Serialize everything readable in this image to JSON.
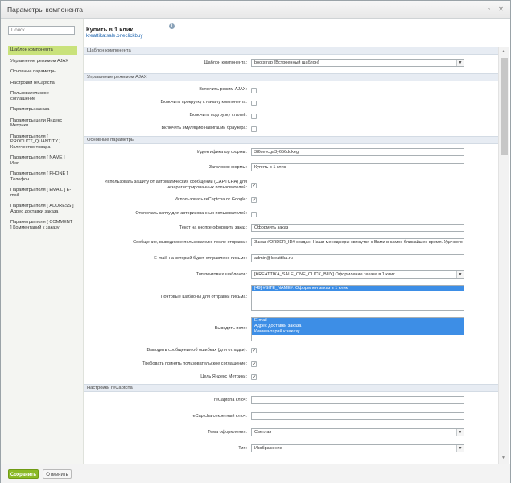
{
  "window": {
    "title": "Параметры компонента"
  },
  "sidebar": {
    "search_placeholder": "Поиск",
    "items": [
      {
        "label": "Шаблон компонента"
      },
      {
        "label": "Управление режимом AJAX"
      },
      {
        "label": "Основные параметры"
      },
      {
        "label": "Настройки reCaptcha"
      },
      {
        "label": "Пользовательское соглашение"
      },
      {
        "label": "Параметры заказа"
      },
      {
        "label": "Параметры цели Яндекс Метрики"
      },
      {
        "label": "Параметры поля [ PRODUCT_QUANTITY ] Количество товара"
      },
      {
        "label": "Параметры поля [ NAME ] Имя"
      },
      {
        "label": "Параметры поля [ PHONE ] Телефон"
      },
      {
        "label": "Параметры поля [ EMAIL ] E-mail"
      },
      {
        "label": "Параметры поля [ ADDRESS ] Адрес доставки заказа"
      },
      {
        "label": "Параметры поля [ COMMENT ] Комментарий к заказу"
      }
    ]
  },
  "header": {
    "component_name": "Купить в 1 клик",
    "component_code": "kreattika:sale.oneclickbuy"
  },
  "sections": {
    "template": "Шаблон компонента",
    "ajax": "Управление режимом AJAX",
    "main": "Основные параметры",
    "recaptcha": "Настройки reCaptcha"
  },
  "fields": {
    "template_label": "Шаблон компонента:",
    "template_value": "bootstrap (Встроенный шаблон)",
    "ajax_mode": "Включить режим AJAX:",
    "ajax_scroll": "Включить прокрутку к началу компонента:",
    "ajax_styles": "Включить подгрузку стилей:",
    "ajax_history": "Включить эмуляцию навигации браузера:",
    "form_id_label": "Идентификатор формы:",
    "form_id_value": "3f6cevcga3y656dokeg",
    "form_title_label": "Заголовок формы:",
    "form_title_value": "Купить в 1 клик",
    "captcha_label": "Использовать защиту от автоматических сообщений (CAPTCHA) для незарегистрированных пользователей:",
    "recaptcha_label": "Использовать reCaptcha от Google:",
    "disable_captcha_label": "Отключать капчу для авторизованных пользователей:",
    "button_text_label": "Текст на кнопке оформить заказ:",
    "button_text_value": "Оформить заказ",
    "message_label": "Сообщение, выводимое пользователю после отправки:",
    "message_value": "Заказ #ORDER_ID# создан. Наши менеджеры свяжутся с Вами в самое ближайшее время. Удачного дня!",
    "email_label": "E-mail, на который будет отправлено письмо:",
    "email_value": "admin@kreattika.ru",
    "event_type_label": "Тип почтовых шаблонов:",
    "event_type_value": "[KREATTIKA_SALE_ONE_CLICK_BUY] Оформление заказа в 1 клик",
    "mail_templates_label": "Почтовые шаблоны для отправки письма:",
    "mail_templates_options": [
      "[49] #SITE_NAME#: Оформлен заказ в 1 клик"
    ],
    "show_fields_label": "Выводить поля:",
    "show_fields_options": [
      "E-mail",
      "Адрес доставки заказа",
      "Комментарий к заказу"
    ],
    "show_errors_label": "Выводить сообщения об ошибках (для отладки):",
    "agreement_label": "Требовать принять пользовательское соглашение:",
    "metrika_label": "Цель Яндекс Метрики:",
    "rc_key_label": "reCaptcha ключ:",
    "rc_secret_label": "reCaptcha секретный ключ:",
    "rc_theme_label": "Тема оформления:",
    "rc_theme_value": "Светлая",
    "rc_type_label": "Тип:",
    "rc_type_value": "Изображение"
  },
  "footer": {
    "save_label": "Сохранить",
    "cancel_label": "Отменить"
  },
  "colors": {
    "accent_green": "#8bb927",
    "link_blue": "#2067b0",
    "selected_blue": "#3d8ee6",
    "section_bg": "#e7ecf3"
  }
}
